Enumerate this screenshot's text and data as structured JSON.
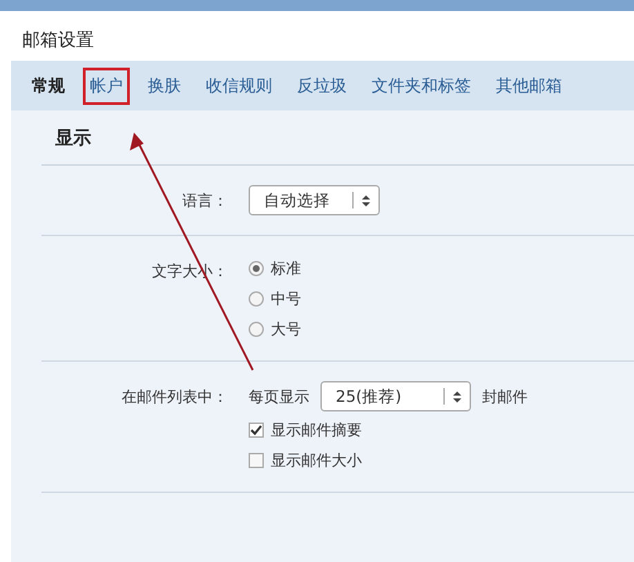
{
  "dialog": {
    "title": "邮箱设置"
  },
  "tabs": [
    {
      "label": "常规",
      "selected": true,
      "annotated": false
    },
    {
      "label": "帐户",
      "selected": false,
      "annotated": true
    },
    {
      "label": "换肤",
      "selected": false,
      "annotated": false
    },
    {
      "label": "收信规则",
      "selected": false,
      "annotated": false
    },
    {
      "label": "反垃圾",
      "selected": false,
      "annotated": false
    },
    {
      "label": "文件夹和标签",
      "selected": false,
      "annotated": false
    },
    {
      "label": "其他邮箱",
      "selected": false,
      "annotated": false
    }
  ],
  "section": {
    "title": "显示"
  },
  "rows": [
    {
      "kind": "select",
      "label": "语言：",
      "value": "自动选择"
    },
    {
      "kind": "radio",
      "label": "文字大小：",
      "options": [
        {
          "label": "标准",
          "selected": true
        },
        {
          "label": "中号",
          "selected": false
        },
        {
          "label": "大号",
          "selected": false
        }
      ]
    },
    {
      "kind": "list",
      "label": "在邮件列表中：",
      "prefix": "每页显示",
      "value": "25(推荐)",
      "suffix": "封邮件",
      "checks": [
        {
          "label": "显示邮件摘要",
          "checked": true
        },
        {
          "label": "显示邮件大小",
          "checked": false
        }
      ]
    }
  ]
}
